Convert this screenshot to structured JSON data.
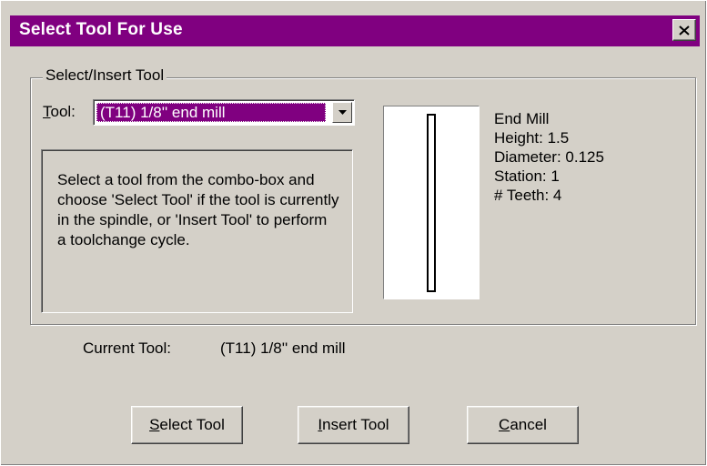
{
  "dialog": {
    "title": "Select Tool For Use",
    "close_icon": "close-icon"
  },
  "group": {
    "legend": "Select/Insert Tool",
    "tool_label_accel": "T",
    "tool_label_rest": "ool:",
    "selected_tool": "(T11) 1/8'' end mill",
    "info_text": "Select a tool from the combo-box and choose 'Select Tool' if the tool is currently in the spindle, or 'Insert Tool' to perform a toolchange cycle.",
    "specs": {
      "type": "End Mill",
      "height": "Height: 1.5",
      "diameter": "Diameter: 0.125",
      "station": "Station: 1",
      "teeth": "# Teeth: 4"
    }
  },
  "current": {
    "label": "Current Tool:",
    "value": "(T11) 1/8'' end mill"
  },
  "buttons": {
    "select": {
      "accel": "S",
      "rest": "elect Tool"
    },
    "insert": {
      "accel": "I",
      "rest": "nsert Tool"
    },
    "cancel": {
      "accel": "C",
      "rest": "ancel"
    }
  },
  "colors": {
    "titlebar": "#800080",
    "face": "#d4d0c8",
    "selection": "#800080"
  }
}
